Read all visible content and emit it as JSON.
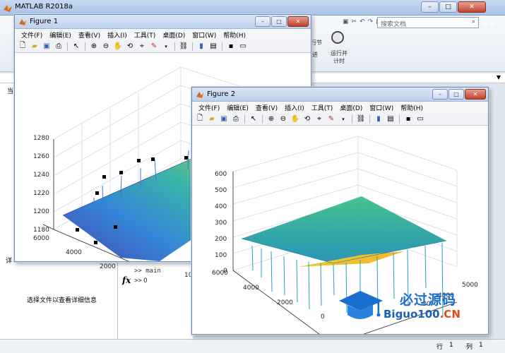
{
  "app": {
    "title": "MATLAB R2018a",
    "search_placeholder": "搜索文档",
    "login_label": "登录",
    "ribbon_items": [
      "行节",
      "进",
      "运行并",
      "计时"
    ],
    "left_panel_text": "选择文件以查看详细信息",
    "left_tab_fragment": "当",
    "left_small_fragment": "详",
    "command_prompt_1": ">> main",
    "command_prompt_2": ">>",
    "status_row_label": "行",
    "status_row_value": "1",
    "status_col_label": "列",
    "status_col_value": "1"
  },
  "figure_menu": [
    "文件(F)",
    "编辑(E)",
    "查看(V)",
    "插入(I)",
    "工具(T)",
    "桌面(D)",
    "窗口(W)",
    "帮助(H)"
  ],
  "figure1": {
    "title": "Figure 1",
    "z_ticks": [
      "1280",
      "1260",
      "1240",
      "1220",
      "1200",
      "1180"
    ],
    "y_ticks": [
      "6000",
      "4000",
      "2000",
      "0"
    ],
    "x_ticks": [
      "10"
    ]
  },
  "figure2": {
    "title": "Figure 2",
    "z_ticks": [
      "600",
      "500",
      "400",
      "300",
      "200",
      "100",
      "0"
    ],
    "y_ticks": [
      "6000",
      "4000",
      "2000",
      "0"
    ],
    "x_ticks": [
      "5000",
      "4000",
      "30"
    ]
  },
  "watermark": {
    "line1": "必过源码",
    "line2_main": "Biguo100",
    "line2_suffix": ".CN"
  },
  "colors": {
    "title_bar": "#bed2ec",
    "surface_low": "#3b3ea8",
    "surface_mid": "#2fb0a4",
    "surface_high": "#f4d83a",
    "marker": "#000000"
  }
}
